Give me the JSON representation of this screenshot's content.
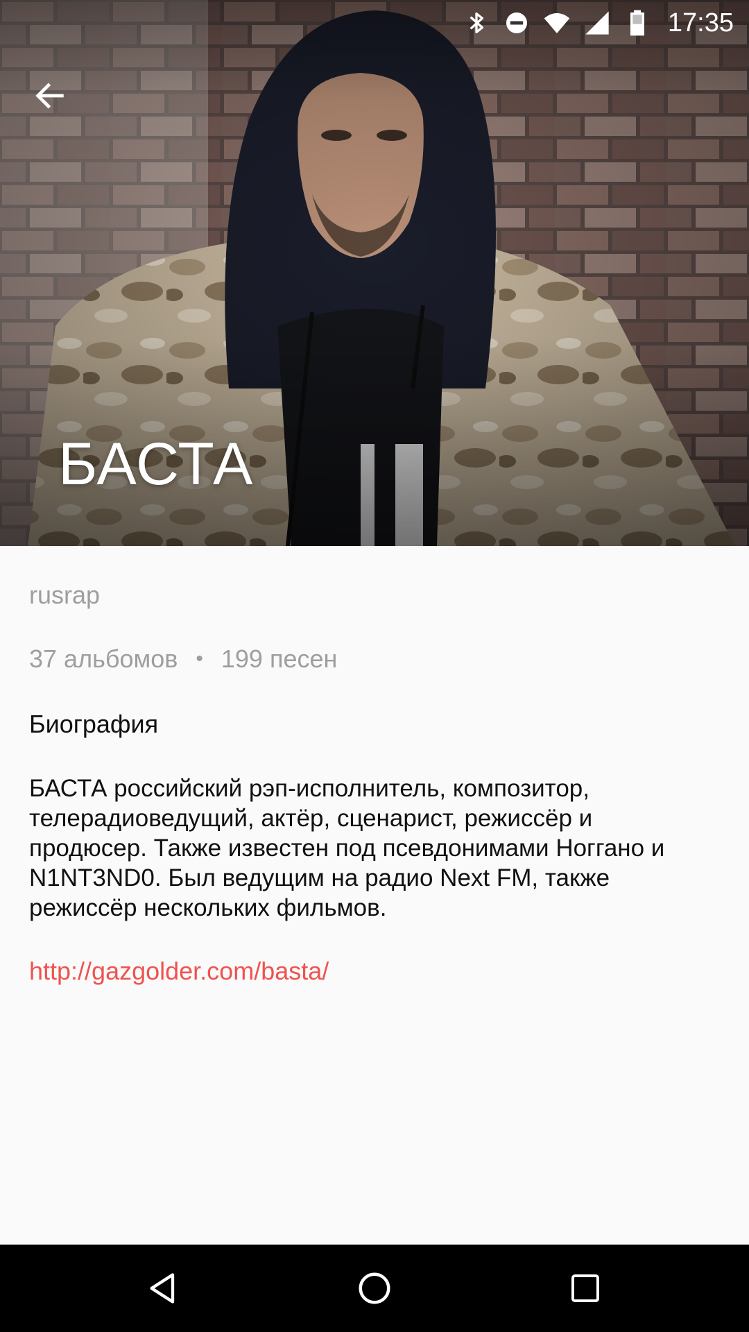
{
  "status_bar": {
    "time": "17:35",
    "icons": [
      "bluetooth-icon",
      "do-not-disturb-icon",
      "wifi-icon",
      "signal-icon",
      "battery-icon"
    ]
  },
  "hero": {
    "artist_name": "БАСТА",
    "back_icon": "back-arrow-icon"
  },
  "artist": {
    "genre": "rusrap",
    "albums": "37 альбомов",
    "separator": "•",
    "songs": "199 песен",
    "bio_title": "Биография",
    "bio_text": "БАСТА российский рэп-исполнитель, композитор, телерадиоведущий, актёр, сценарист, режиссёр и продюсер. Также известен под псевдонимами Ноггано и N1NT3ND0. Был ведущим на радио Next FM, также режиссёр нескольких фильмов.",
    "link": "http://gazgolder.com/basta/"
  },
  "nav_bar": {
    "icons": [
      "nav-back-icon",
      "nav-home-icon",
      "nav-recents-icon"
    ]
  },
  "colors": {
    "background": "#fafafa",
    "secondary_text": "#9e9e9e",
    "primary_text": "#111111",
    "link": "#ef5350",
    "nav_bar": "#000000"
  }
}
